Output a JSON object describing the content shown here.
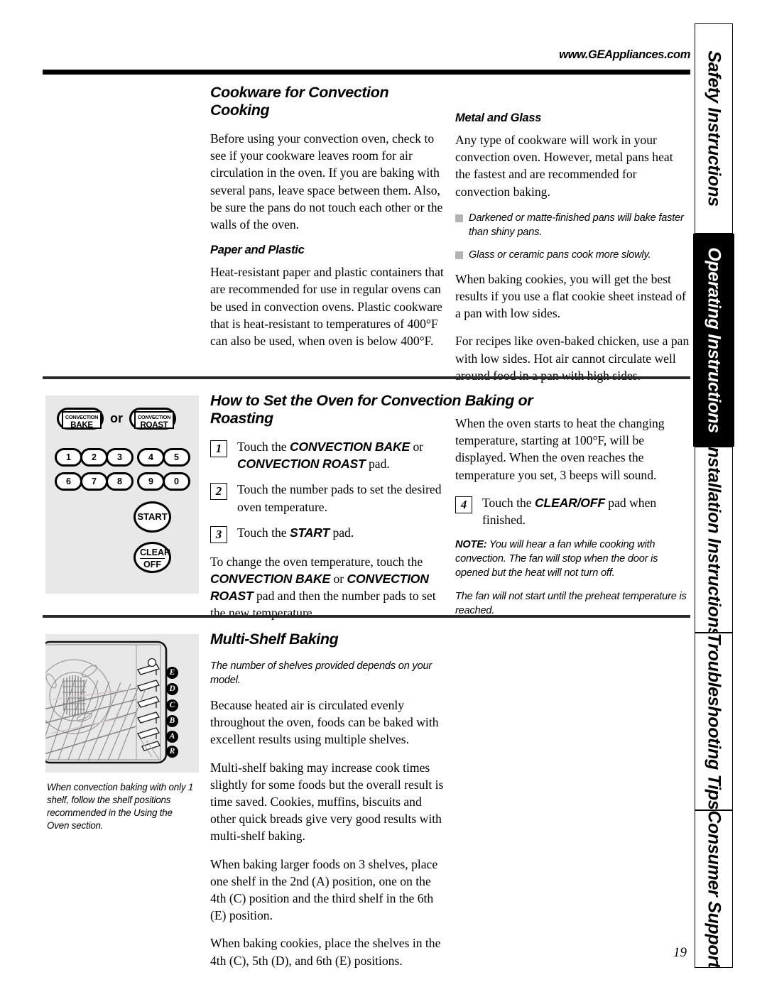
{
  "header": {
    "url": "www.GEAppliances.com"
  },
  "page_number": "19",
  "side_tabs": [
    {
      "label": "Safety Instructions",
      "active": false
    },
    {
      "label": "Operating Instructions",
      "active": true
    },
    {
      "label": "Installation Instructions",
      "active": false
    },
    {
      "label": "Troubleshooting Tips",
      "active": false
    },
    {
      "label": "Consumer Support",
      "active": false
    }
  ],
  "section_cookware": {
    "title": "Cookware for Convection Cooking",
    "intro": "Before using your convection oven, check to see if your cookware leaves room for air circulation in the oven. If you are baking with several pans, leave space between them. Also, be sure the pans do not touch each other or the walls of the oven.",
    "paper_plastic": {
      "heading": "Paper and Plastic",
      "body": "Heat-resistant paper and plastic containers that are recommended for use in regular ovens can be used in convection ovens. Plastic cookware that is heat-resistant to temperatures of 400°F can also be used, when oven is below 400°F."
    },
    "metal_glass": {
      "heading": "Metal and Glass",
      "body": "Any type of cookware will work in your convection oven. However, metal pans heat the fastest and are recommended for convection baking.",
      "bullets": [
        "Darkened or matte-finished pans will bake faster than shiny pans.",
        "Glass or ceramic pans cook more slowly."
      ],
      "para2": "When baking cookies, you will get the best results if you use a flat cookie sheet instead of a pan with low sides.",
      "para3": "For recipes like oven-baked chicken, use a pan with low sides. Hot air cannot circulate well around food in a pan with high sides."
    }
  },
  "section_howto": {
    "title": "How to Set the Oven for Convection Baking or Roasting",
    "steps": [
      {
        "num": "1",
        "text_parts": [
          {
            "t": "Touch the ",
            "b": false
          },
          {
            "t": "CONVECTION BAKE",
            "b": true
          },
          {
            "t": " or ",
            "b": false
          },
          {
            "t": "CONVECTION ROAST",
            "b": true
          },
          {
            "t": " pad.",
            "b": false
          }
        ]
      },
      {
        "num": "2",
        "text_parts": [
          {
            "t": "Touch the number pads to set the desired oven temperature.",
            "b": false
          }
        ]
      },
      {
        "num": "3",
        "text_parts": [
          {
            "t": "Touch the ",
            "b": false
          },
          {
            "t": "START",
            "b": true
          },
          {
            "t": " pad.",
            "b": false
          }
        ]
      }
    ],
    "change_temp_parts": [
      {
        "t": "To change the oven temperature, touch the ",
        "b": false
      },
      {
        "t": "CONVECTION BAKE",
        "b": true
      },
      {
        "t": " or ",
        "b": false
      },
      {
        "t": "CONVECTION ROAST",
        "b": true
      },
      {
        "t": " pad and then the number pads to set the new temperature.",
        "b": false
      }
    ],
    "right_intro": "When the oven starts to heat the changing temperature, starting at 100°F, will be displayed. When the oven reaches the temperature you set, 3 beeps will sound.",
    "step4": {
      "num": "4",
      "text_parts": [
        {
          "t": "Touch the ",
          "b": false
        },
        {
          "t": "CLEAR/OFF",
          "b": true
        },
        {
          "t": " pad when finished.",
          "b": false
        }
      ]
    },
    "note_label": "NOTE:",
    "note_text": " You will hear a fan while cooking with convection. The fan will stop when the door is opened but the heat will not turn off.",
    "note_text2": "The fan will not start until the preheat temperature is reached."
  },
  "control_panel": {
    "convection_bake": {
      "line1": "CONVECTION",
      "line2": "BAKE"
    },
    "or": "or",
    "convection_roast": {
      "line1": "CONVECTION",
      "line2": "ROAST"
    },
    "number_keys_row1": [
      "1",
      "2",
      "3",
      "4",
      "5"
    ],
    "number_keys_row2": [
      "6",
      "7",
      "8",
      "9",
      "0"
    ],
    "start": "START",
    "clear_off": {
      "line1": "CLEAR",
      "line2": "OFF"
    }
  },
  "section_multishelf": {
    "title": "Multi-Shelf Baking",
    "note": "The number of shelves provided depends on your model.",
    "para1": "Because heated air is circulated evenly throughout the oven, foods can be baked with excellent results using multiple shelves.",
    "para2": "Multi-shelf baking may increase cook times slightly for some foods but the overall result is time saved. Cookies, muffins, biscuits and other quick breads give very good results with multi-shelf baking.",
    "para3": "When baking larger foods on 3 shelves, place one shelf in the 2nd (A) position, one on the 4th (C) position and the third shelf in the 6th (E) position.",
    "para4": "When baking cookies, place the shelves in the 4th (C), 5th (D), and 6th (E) positions."
  },
  "oven_graphic": {
    "shelf_labels": [
      "E",
      "D",
      "C",
      "B",
      "A",
      "R"
    ],
    "caption": "When convection baking with only 1 shelf, follow the shelf positions recommended in the Using the Oven section."
  }
}
